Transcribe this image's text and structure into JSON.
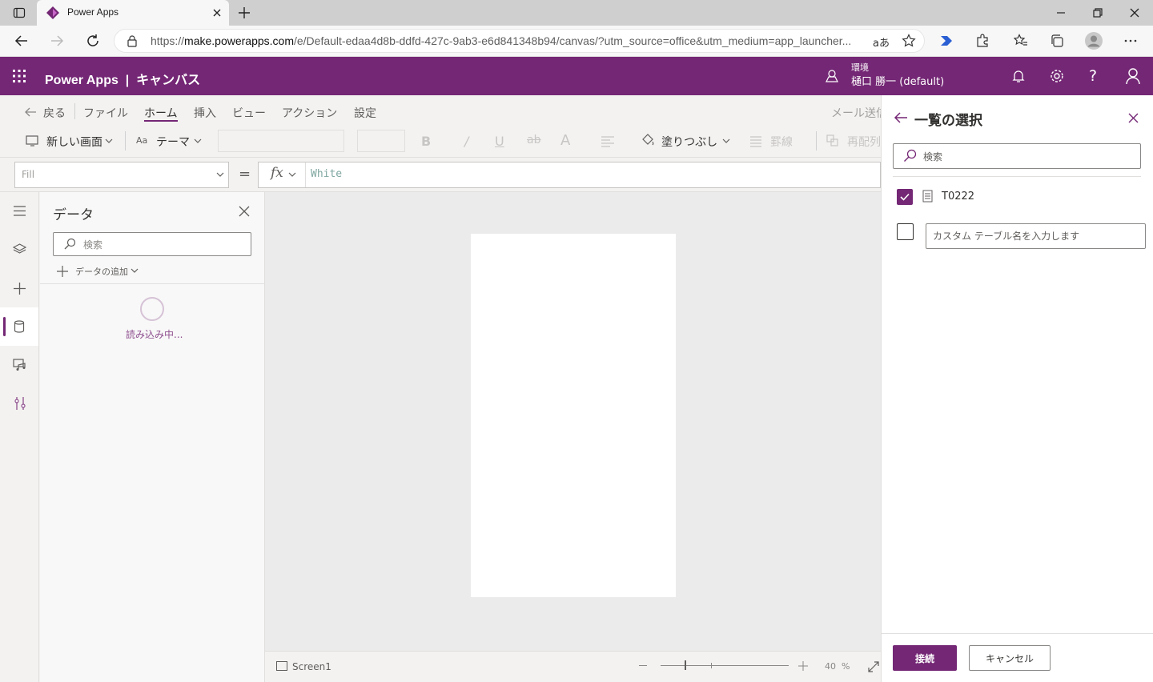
{
  "browser": {
    "tab_title": "Power Apps",
    "url_prefix": "https://",
    "url_host": "make.powerapps.com",
    "url_path": "/e/Default-edaa4d8b-ddfd-427c-9ab3-e6d841348b94/canvas/?utm_source=office&utm_medium=app_launcher...",
    "read_aloud": "aあ"
  },
  "header": {
    "app_title": "Power Apps  |  キャンバス",
    "env_label": "環境",
    "env_name": "樋口 勝一 (default)"
  },
  "menu": {
    "back": "戻る",
    "items": [
      "ファイル",
      "ホーム",
      "挿入",
      "ビュー",
      "アクション",
      "設定"
    ],
    "email": "メール送信"
  },
  "toolbar": {
    "new_screen": "新しい画面",
    "theme": "テーマ",
    "fill": "塗りつぶし",
    "border": "罫線",
    "reorder": "再配列"
  },
  "formula": {
    "property": "Fill",
    "equals": "=",
    "fx": "fx",
    "value": "White"
  },
  "data_pane": {
    "title": "データ",
    "search_placeholder": "検索",
    "add_data": "データの追加",
    "loading": "読み込み中..."
  },
  "status": {
    "screen_name": "Screen1",
    "zoom": "40  %"
  },
  "right_panel": {
    "title": "一覧の選択",
    "search_placeholder": "検索",
    "items": [
      {
        "label": "T0222",
        "checked": true
      }
    ],
    "custom_placeholder": "カスタム テーブル名を入力します",
    "connect": "接続",
    "cancel": "キャンセル"
  },
  "colors": {
    "brand": "#742774"
  }
}
